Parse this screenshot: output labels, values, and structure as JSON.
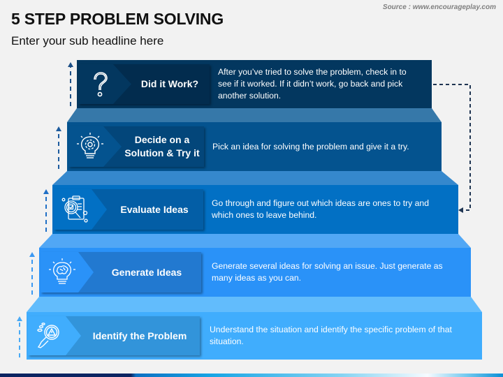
{
  "header": {
    "title": "5 STEP PROBLEM SOLVING",
    "subtitle": "Enter your sub headline here",
    "source": "Source : www.encourageplay.com"
  },
  "steps": [
    {
      "order": 5,
      "label": "Did it Work?",
      "description": "After you’ve tried to solve the problem, check in to see if it worked. If it didn’t work, go back and pick another solution.",
      "icon": "question-mark-icon",
      "face_color": "#03375f",
      "label_color": "#022c4e",
      "chevron_color": "#03375f",
      "bevel_color": "#3678a9"
    },
    {
      "order": 4,
      "label": "Decide on a Solution & Try it",
      "description": "Pick an idea for solving the problem and give it a try.",
      "icon": "lightbulb-gear-icon",
      "face_color": "#04538f",
      "label_color": "#03467a",
      "chevron_color": "#04538f",
      "bevel_color": "#3588cd"
    },
    {
      "order": 3,
      "label": "Evaluate Ideas",
      "description": "Go through and figure out which ideas are ones to try and which ones to leave behind.",
      "icon": "clipboard-magnifier-icon",
      "face_color": "#0270c4",
      "label_color": "#035ea6",
      "chevron_color": "#0270c4",
      "bevel_color": "#51a7f5"
    },
    {
      "order": 2,
      "label": "Generate Ideas",
      "description": "Generate several ideas for solving an issue. Just generate as many ideas as you can.",
      "icon": "lightbulb-brain-icon",
      "face_color": "#2a92f8",
      "label_color": "#2279d0",
      "chevron_color": "#2a92f8",
      "bevel_color": "#62bcfc"
    },
    {
      "order": 1,
      "label": "Identify the Problem",
      "description": "Understand the situation and identify the specific problem of that situation.",
      "icon": "magnifier-warning-icon",
      "face_color": "#40adfd",
      "label_color": "#3294da",
      "chevron_color": "#40adfd",
      "bevel_color": null
    }
  ],
  "connectors": {
    "feedback_loop": "from-did-it-work-to-evaluate-ideas",
    "line_color": "#1f3552",
    "step_arrow_colors": [
      "#1d4f86",
      "#1d5b9e",
      "#1f6fc6",
      "#3b98f2",
      "#4aaaf5"
    ]
  },
  "footer": {
    "bar_colors": [
      "#0b2461",
      "#0c6fc1",
      "#86d4f3",
      "#f6fbff",
      "#0b8fd6"
    ]
  }
}
